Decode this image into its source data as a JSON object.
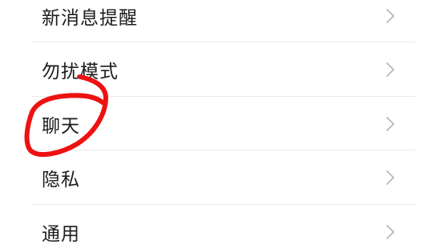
{
  "settings_list": {
    "items": [
      {
        "label": "新消息提醒",
        "icon": "chevron-right-icon"
      },
      {
        "label": "勿扰模式",
        "icon": "chevron-right-icon"
      },
      {
        "label": "聊天",
        "icon": "chevron-right-icon"
      },
      {
        "label": "隐私",
        "icon": "chevron-right-icon"
      },
      {
        "label": "通用",
        "icon": "chevron-right-icon"
      }
    ]
  },
  "annotation": {
    "shape": "hand-drawn-circle",
    "color": "#ee1111",
    "target": "聊天"
  },
  "colors": {
    "background": "#ffffff",
    "text": "#1c1c1c",
    "chevron": "#b8b8b8",
    "divider": "#e9e9e9"
  }
}
